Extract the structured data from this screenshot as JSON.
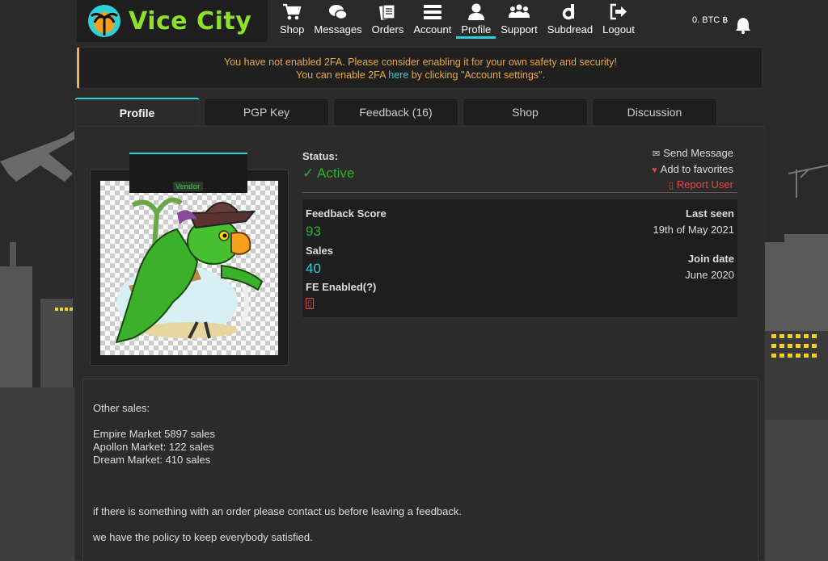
{
  "brand": {
    "name": "Vice City"
  },
  "nav": [
    {
      "label": "Shop",
      "icon": "cart-icon"
    },
    {
      "label": "Messages",
      "icon": "chat-icon"
    },
    {
      "label": "Orders",
      "icon": "orders-icon"
    },
    {
      "label": "Account",
      "icon": "menu-icon"
    },
    {
      "label": "Profile",
      "icon": "user-icon",
      "active": true
    },
    {
      "label": "Support",
      "icon": "group-icon"
    },
    {
      "label": "Subdread",
      "icon": "dread-icon"
    },
    {
      "label": "Logout",
      "icon": "logout-icon"
    }
  ],
  "wallet": {
    "balance": "0. BTC ฿"
  },
  "alert": {
    "line1": "You have not enabled 2FA. Please consider enabling it for your own safety and security!",
    "line2_pre": "You can enable 2FA ",
    "line2_link": "here",
    "line2_post": " by clicking \"Account settings\"."
  },
  "tabs": [
    {
      "label": "Profile",
      "active": true
    },
    {
      "label": "PGP Key"
    },
    {
      "label": "Feedback (16)"
    },
    {
      "label": "Shop"
    },
    {
      "label": "Discussion"
    }
  ],
  "profile": {
    "badge": "Vendor",
    "status_label": "Status:",
    "status_value": "✓ Active",
    "actions": {
      "send_message": "Send Message",
      "add_favorites": "Add to favorites",
      "report": "Report User"
    },
    "stats": {
      "feedback_label": "Feedback Score",
      "feedback_value": "93",
      "sales_label": "Sales",
      "sales_value": "40",
      "fe_label": "FE Enabled(?)",
      "last_seen_label": "Last seen",
      "last_seen_value": "19th of May 2021",
      "join_label": "Join date",
      "join_value": "June 2020"
    }
  },
  "description": {
    "line1": "Other sales:",
    "line2": "Empire Market 5897 sales",
    "line3": "Apollon Market: 122 sales",
    "line4": "Dream Market: 410 sales",
    "line5": "if there is something with an order please contact us before leaving a feedback.",
    "line6": "we have the policy to keep everybody satisfied."
  },
  "colors": {
    "accent": "#2fd0d8",
    "active": "#2ab02a",
    "warning": "#e8a845",
    "danger": "#e54848",
    "brand": "#8fe02a"
  }
}
